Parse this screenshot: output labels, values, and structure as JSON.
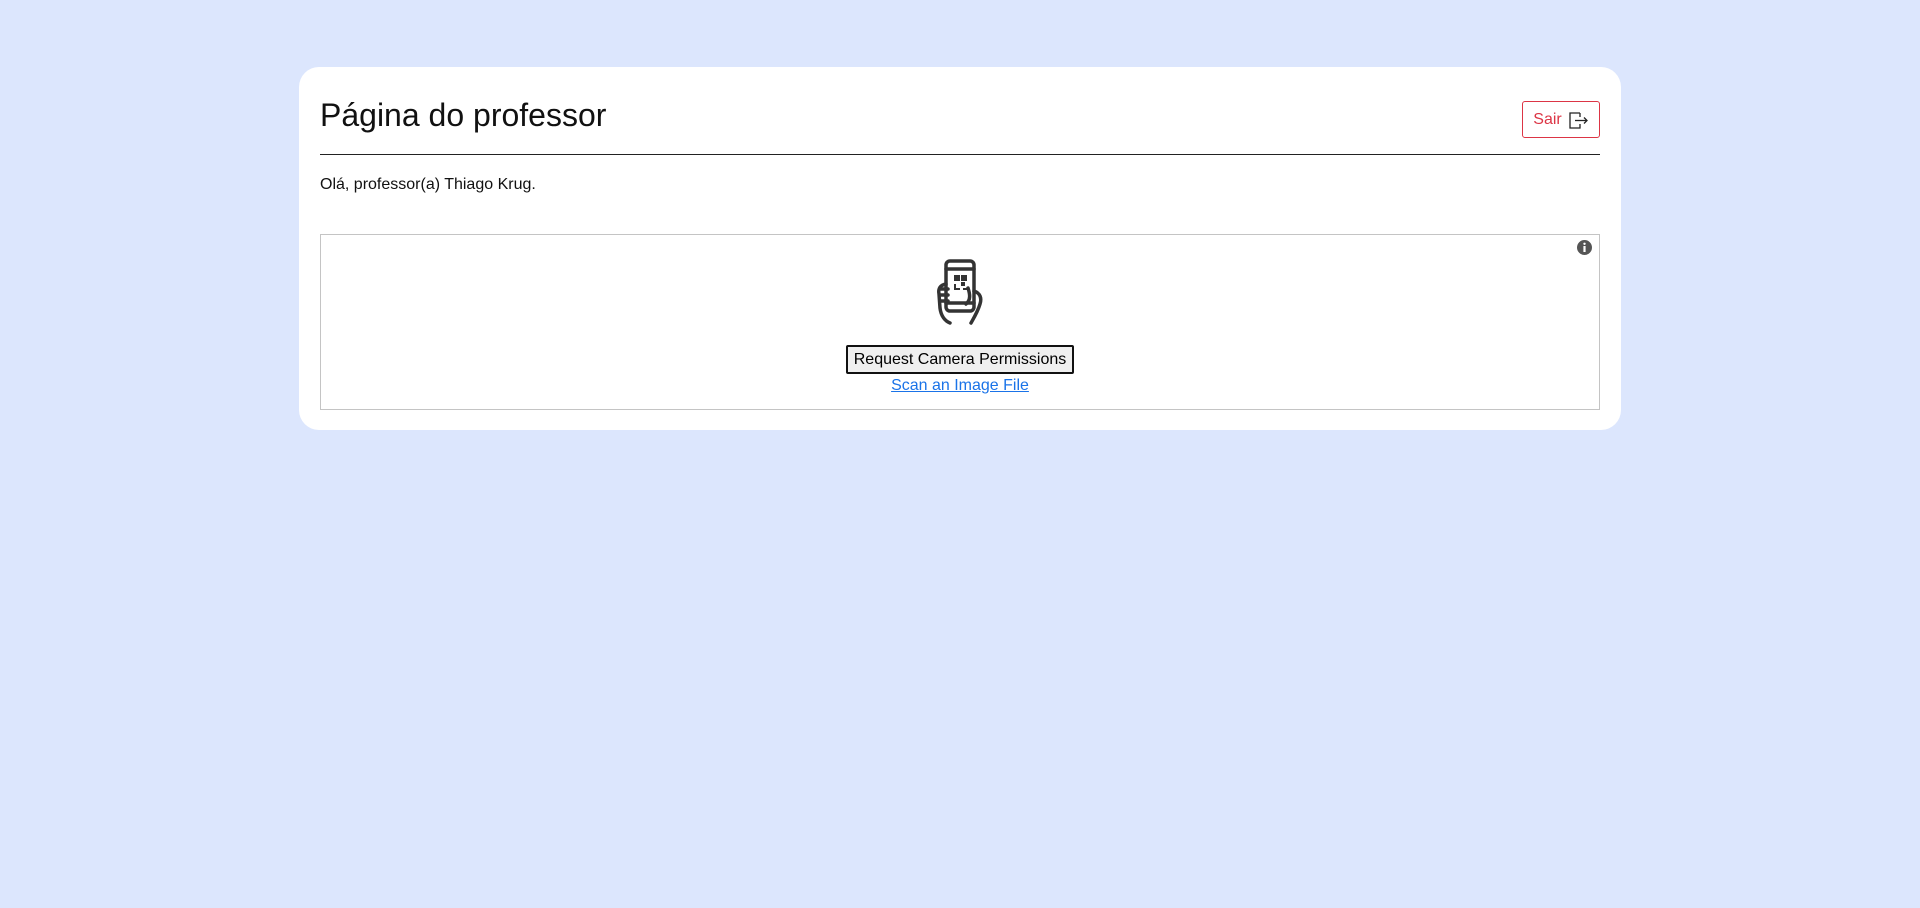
{
  "page": {
    "title": "Página do professor",
    "greeting": "Olá, professor(a) Thiago Krug."
  },
  "header": {
    "logout_label": "Sair",
    "logout_icon": "logout-icon"
  },
  "scanner": {
    "info_icon": "info-icon",
    "illustration": "phone-qr-scan-icon",
    "request_camera_label": "Request Camera Permissions",
    "scan_file_label": "Scan an Image File"
  },
  "colors": {
    "background": "#dce6fd",
    "card": "#ffffff",
    "danger": "#dc3545",
    "link": "#1a73e8"
  }
}
